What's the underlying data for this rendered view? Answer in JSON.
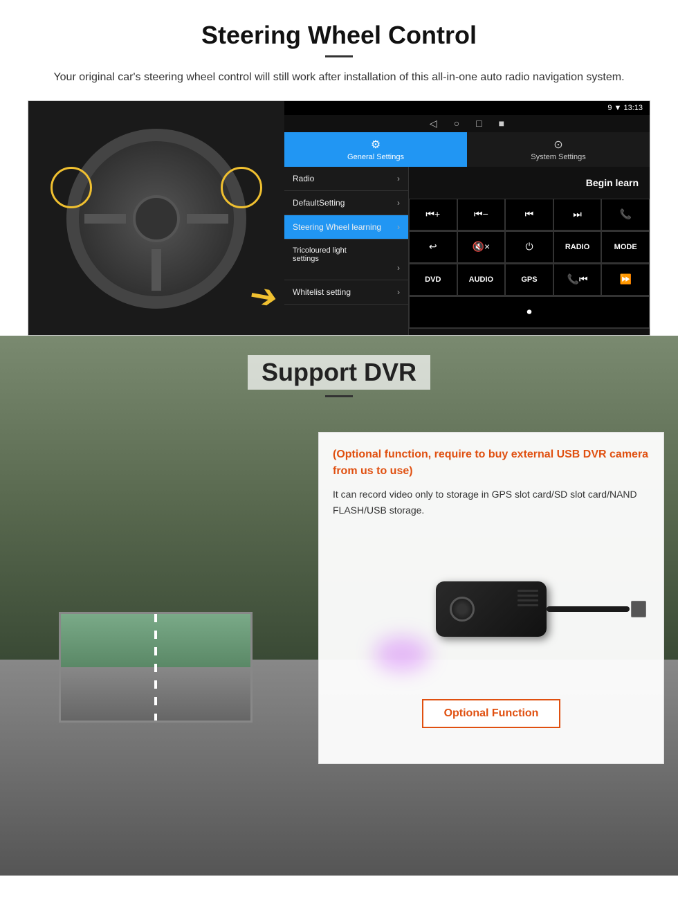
{
  "swc": {
    "title": "Steering Wheel Control",
    "subtitle": "Your original car's steering wheel control will still work after installation of this all-in-one auto radio navigation system.",
    "android": {
      "statusbar": "9 ▼ 13:13",
      "nav_back": "◁",
      "nav_home": "○",
      "nav_recent": "□",
      "nav_dot": "■",
      "tab_general_label": "General Settings",
      "tab_general_icon": "⚙",
      "tab_system_label": "System Settings",
      "tab_system_icon": "⊙",
      "menu_items": [
        {
          "label": "Radio",
          "active": false
        },
        {
          "label": "DefaultSetting",
          "active": false
        },
        {
          "label": "Steering Wheel learning",
          "active": true
        },
        {
          "label": "Tricoloured light settings",
          "active": false,
          "multiline": true
        },
        {
          "label": "Whitelist setting",
          "active": false
        }
      ],
      "begin_learn": "Begin learn",
      "buttons_row1": [
        "⏮+",
        "⏮−",
        "⏮",
        "⏭",
        "📞"
      ],
      "buttons_row2": [
        "↩",
        "🔇×",
        "⏻",
        "RADIO",
        "MODE"
      ],
      "buttons_row3": [
        "DVD",
        "AUDIO",
        "GPS",
        "📞⏮",
        "⏩⏭"
      ],
      "buttons_row4_icon": "⏺"
    }
  },
  "dvr": {
    "title": "Support DVR",
    "card_title": "(Optional function, require to buy external USB DVR camera from us to use)",
    "card_body": "It can record video only to storage in GPS slot card/SD slot card/NAND FLASH/USB storage.",
    "optional_button": "Optional Function"
  }
}
